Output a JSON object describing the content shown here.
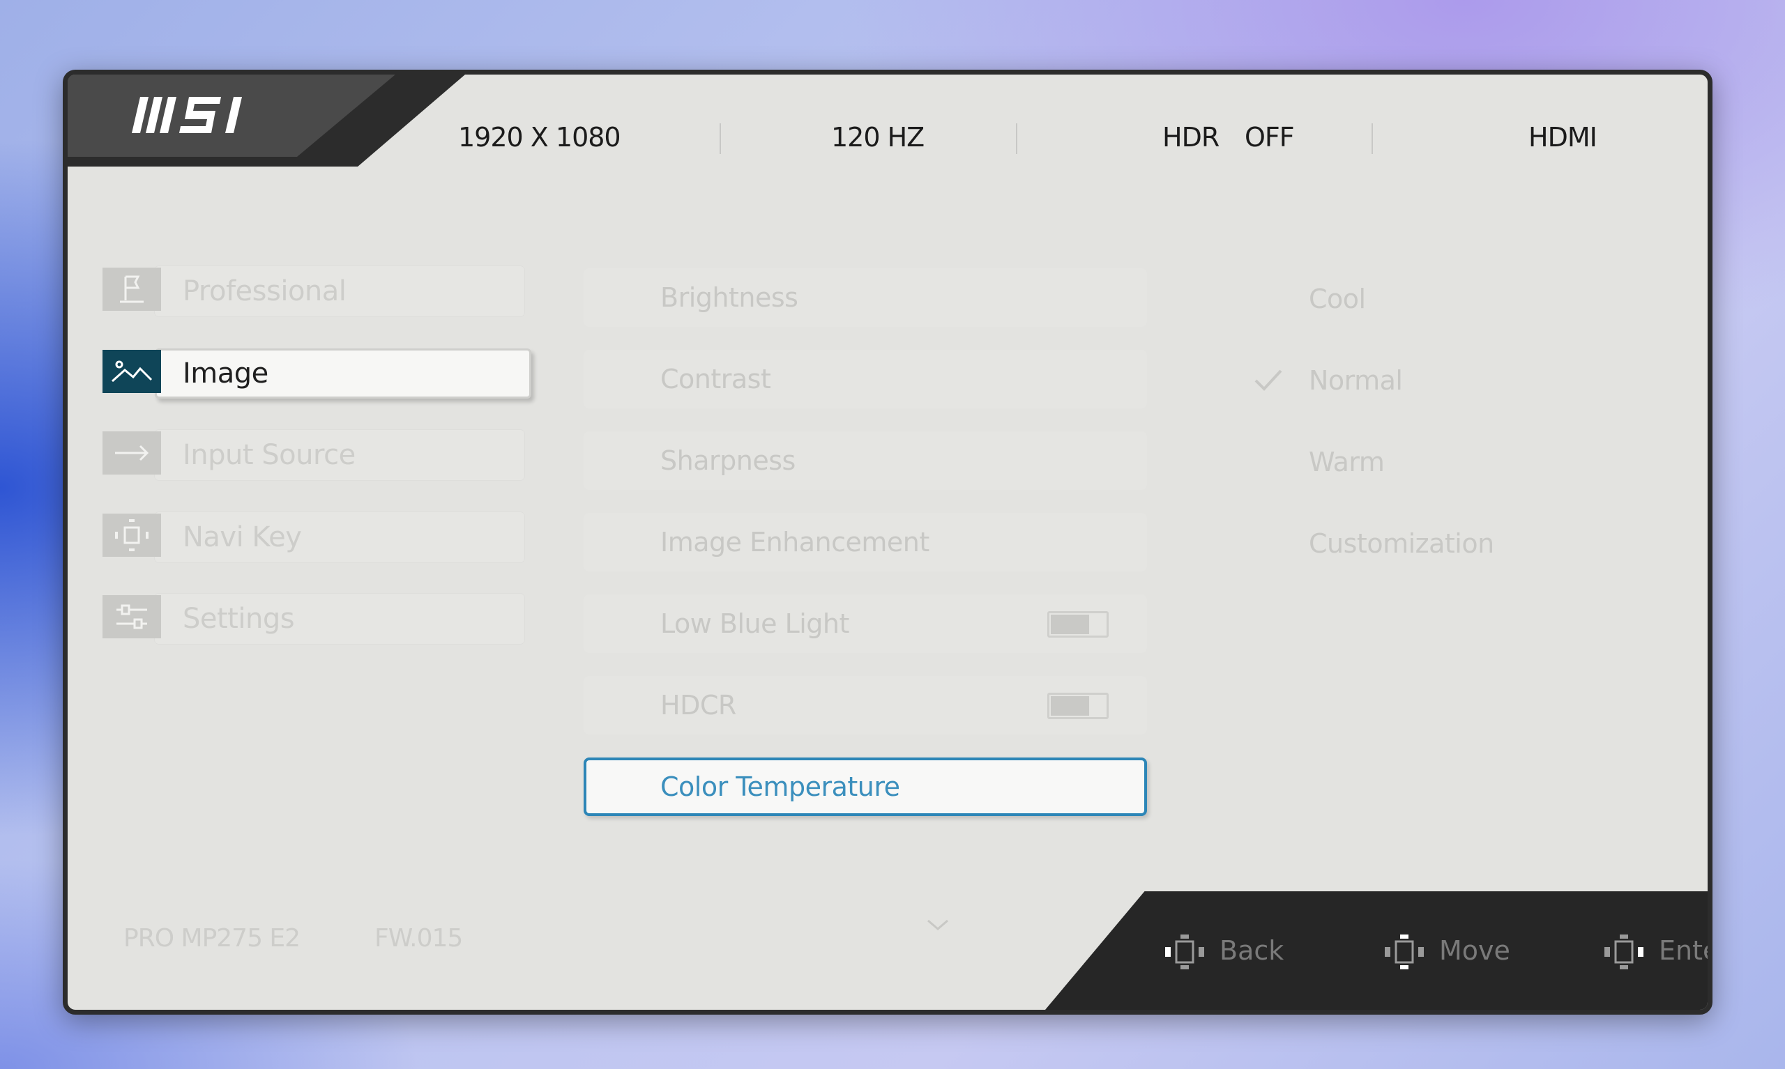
{
  "brand": {
    "logo_text": "MSI"
  },
  "status": {
    "resolution": "1920 X 1080",
    "refresh": "120 HZ",
    "hdr_label": "HDR",
    "hdr_value": "OFF",
    "input": "HDMI"
  },
  "menu": [
    {
      "label": "Professional",
      "icon": "flag-icon"
    },
    {
      "label": "Image",
      "icon": "image-icon",
      "active": true
    },
    {
      "label": "Input Source",
      "icon": "arrow-right-icon"
    },
    {
      "label": "Navi Key",
      "icon": "navi-key-icon"
    },
    {
      "label": "Settings",
      "icon": "sliders-icon"
    }
  ],
  "image_menu": [
    {
      "label": "Brightness"
    },
    {
      "label": "Contrast"
    },
    {
      "label": "Sharpness"
    },
    {
      "label": "Image Enhancement"
    },
    {
      "label": "Low Blue Light",
      "toggle": "off"
    },
    {
      "label": "HDCR",
      "toggle": "off"
    },
    {
      "label": "Color Temperature",
      "selected": true
    }
  ],
  "color_temperature_options": [
    {
      "label": "Cool"
    },
    {
      "label": "Normal",
      "checked": true
    },
    {
      "label": "Warm"
    },
    {
      "label": "Customization"
    }
  ],
  "footer": {
    "model": "PRO MP275 E2",
    "firmware": "FW.015",
    "back_label": "Back",
    "move_label": "Move",
    "enter_label": "Enter"
  },
  "colors": {
    "accent": "#2d86b7",
    "active_icon_bg": "#0f4558",
    "panel_bg": "#e3e3e0",
    "frame": "#2c2c2c"
  }
}
